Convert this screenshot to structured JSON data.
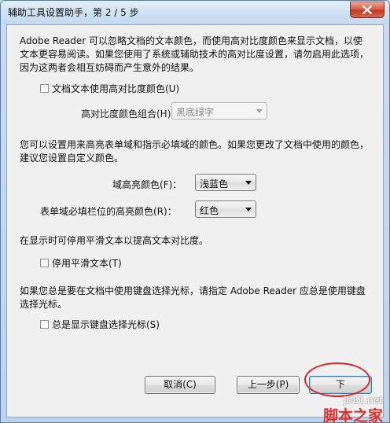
{
  "window": {
    "title": "辅助工具设置助手，第 2 / 5 步"
  },
  "section1": {
    "text": "Adobe Reader 可以忽略文档的文本颜色，而使用高对比度颜色来显示文档，以使文本更容易阅读。如果您使用了系统或辅助技术的高对比度设置，请勿启用此选项，因为这两者会相互妨碍而产生意外的结果。",
    "checkbox_label": "文档文本使用高对比度颜色(U)",
    "combo_label": "高对比度颜色组合(H)：",
    "combo_value": "黑底绿字"
  },
  "section2": {
    "text": "您可以设置用来高亮表单域和指示必填域的颜色。如果您更改了文档中使用的颜色，建议您设置自定义颜色。",
    "field_highlight_label": "域高亮颜色(F)：",
    "field_highlight_value": "浅蓝色",
    "required_highlight_label": "表单域必填栏位的高亮颜色(R)：",
    "required_highlight_value": "红色"
  },
  "section3": {
    "text": "在显示时可停用平滑文本以提高文本对比度。",
    "checkbox_label": "停用平滑文本(T)"
  },
  "section4": {
    "text": "如果您总是要在文档中使用键盘选择光标，请指定 Adobe Reader 应总是使用键盘选择光标。",
    "checkbox_label": "总是显示键盘选择光标(S)"
  },
  "buttons": {
    "cancel": "取消(C)",
    "back": "上一步(P)",
    "next": "下"
  },
  "watermark": {
    "url": "jb51.net",
    "brand": "脚本之家"
  },
  "colors": {
    "annotation": "#d7262f"
  }
}
